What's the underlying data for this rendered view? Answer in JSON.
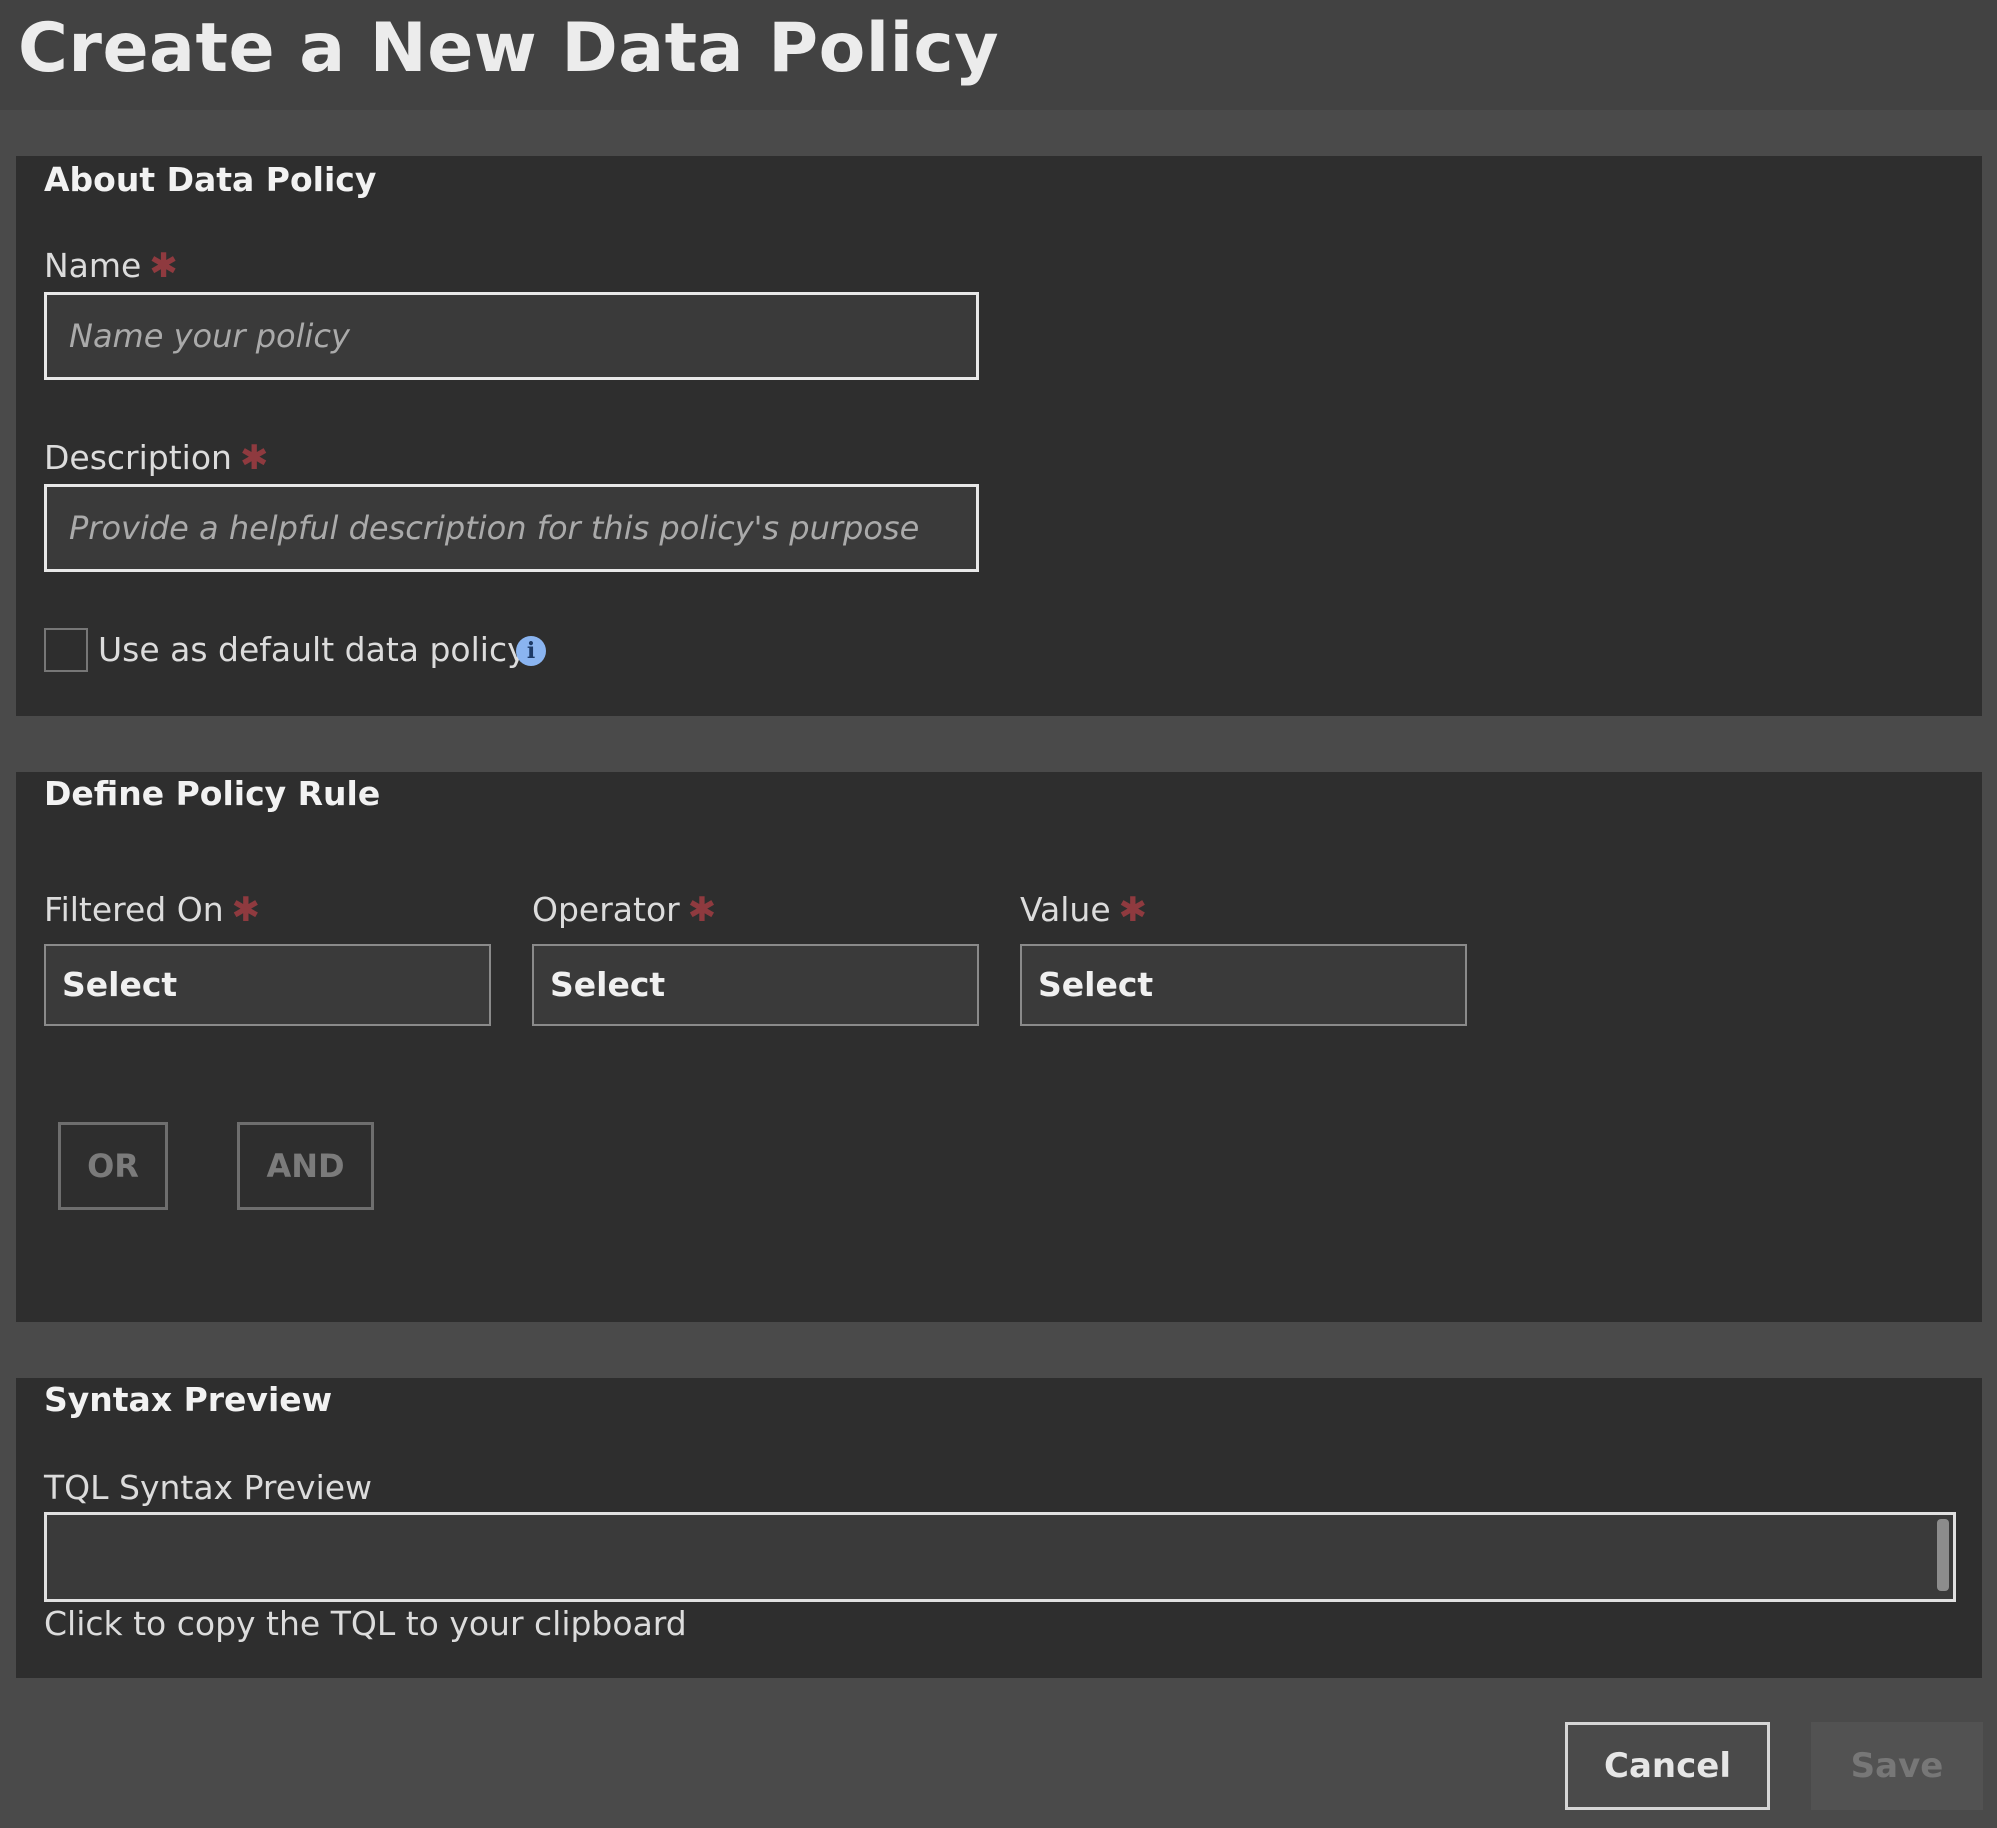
{
  "page": {
    "title": "Create a New Data Policy"
  },
  "about": {
    "title": "About Data Policy",
    "name_label": "Name",
    "name_placeholder": "Name your policy",
    "name_value": "",
    "description_label": "Description",
    "description_placeholder": "Provide a helpful description for this policy's purpose",
    "description_value": "",
    "default_checkbox_label": "Use as default data policy",
    "default_checkbox_checked": false,
    "info_icon": "info-icon"
  },
  "rule": {
    "title": "Define Policy Rule",
    "filtered_on_label": "Filtered On",
    "filtered_on_value": "Select",
    "operator_label": "Operator",
    "operator_value": "Select",
    "value_label": "Value",
    "value_value": "Select",
    "or_label": "OR",
    "and_label": "AND"
  },
  "preview": {
    "title": "Syntax Preview",
    "tql_label": "TQL Syntax Preview",
    "tql_value": "",
    "copy_hint": "Click to copy the TQL to your clipboard"
  },
  "footer": {
    "cancel_label": "Cancel",
    "save_label": "Save"
  },
  "colors": {
    "page_bg": "#4a4a4a",
    "panel_bg": "#2e2e2e",
    "required_asterisk": "#8f3a3f",
    "info_icon": "#8ab4f0"
  }
}
